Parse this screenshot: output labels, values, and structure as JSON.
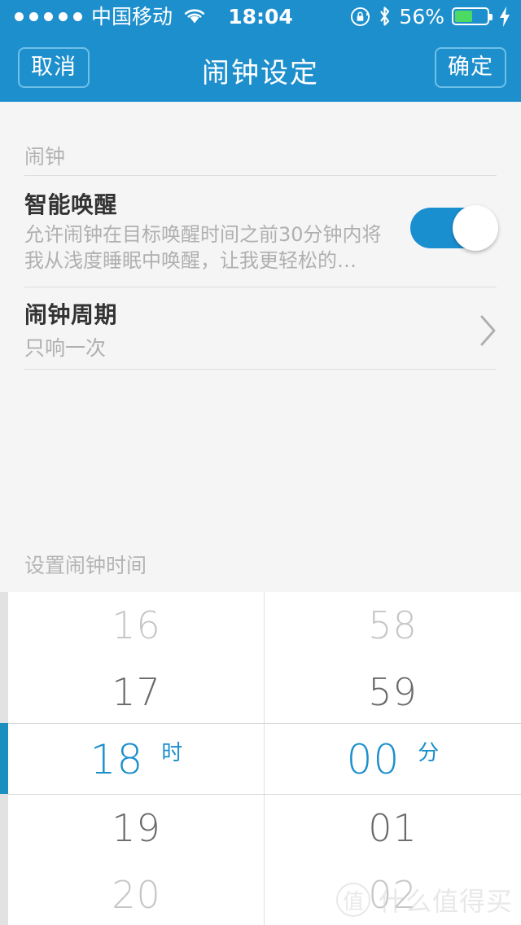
{
  "status_bar": {
    "signal_dots": 5,
    "carrier": "中国移动",
    "wifi_icon": "wifi-icon",
    "time": "18:04",
    "rotation_lock_icon": "rotation-lock-icon",
    "bluetooth_icon": "bluetooth-icon",
    "battery_percent_label": "56%",
    "battery_level": 56,
    "charging_icon": "charging-bolt-icon",
    "bar_color": "#1e8fcd",
    "battery_fill_color": "#4cd964"
  },
  "nav_bar": {
    "cancel_label": "取消",
    "title": "闹钟设定",
    "confirm_label": "确定"
  },
  "alarm_section": {
    "header": "闹钟",
    "smart_wake": {
      "title": "智能唤醒",
      "description": "允许闹钟在目标唤醒时间之前30分钟内将我从浅度睡眠中唤醒，让我更轻松的…",
      "toggle_on": true,
      "toggle_color": "#1a8fd0"
    },
    "cycle": {
      "title": "闹钟周期",
      "value": "只响一次",
      "chevron_icon": "chevron-right-icon"
    }
  },
  "picker_section": {
    "header": "设置闹钟时间",
    "accent_color": "#1a8fcc",
    "hour_unit": "时",
    "minute_unit": "分",
    "selected_hour": "18",
    "selected_minute": "00",
    "hours": [
      {
        "value": "16",
        "state": "faint"
      },
      {
        "value": "17",
        "state": "normal"
      },
      {
        "value": "18",
        "state": "selected"
      },
      {
        "value": "19",
        "state": "normal"
      },
      {
        "value": "20",
        "state": "faint"
      }
    ],
    "minutes": [
      {
        "value": "58",
        "state": "faint"
      },
      {
        "value": "59",
        "state": "normal"
      },
      {
        "value": "00",
        "state": "selected"
      },
      {
        "value": "01",
        "state": "normal"
      },
      {
        "value": "02",
        "state": "faint"
      }
    ]
  },
  "watermark": {
    "logo_char": "值",
    "text": "什么值得买"
  }
}
